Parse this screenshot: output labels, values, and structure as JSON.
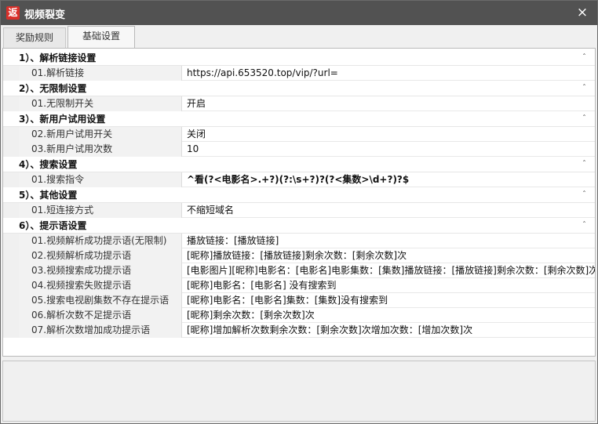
{
  "window": {
    "title": "视频裂变",
    "icon_glyph": "返",
    "close_glyph": "×"
  },
  "tabs": [
    {
      "label": "奖励规则",
      "active": false
    },
    {
      "label": "基础设置",
      "active": true
    }
  ],
  "categories": [
    {
      "title": "1）、解析链接设置",
      "rows": [
        {
          "name": "01.解析链接",
          "value": "https://api.653520.top/vip/?url="
        }
      ]
    },
    {
      "title": "2）、无限制设置",
      "rows": [
        {
          "name": "01.无限制开关",
          "value": "开启"
        }
      ]
    },
    {
      "title": "3）、新用户试用设置",
      "rows": [
        {
          "name": "02.新用户试用开关",
          "value": "关闭"
        },
        {
          "name": "03.新用户试用次数",
          "value": "10"
        }
      ]
    },
    {
      "title": "4）、搜索设置",
      "rows": [
        {
          "name": "01.搜索指令",
          "value": "^看(?<电影名>.+?)(?:\\s+?)?(?<集数>\\d+?)?$"
        }
      ]
    },
    {
      "title": "5）、其他设置",
      "rows": [
        {
          "name": "01.短连接方式",
          "value": "不缩短域名"
        }
      ]
    },
    {
      "title": "6）、提示语设置",
      "rows": [
        {
          "name": "01.视频解析成功提示语(无限制)",
          "value": "播放链接：[播放链接]"
        },
        {
          "name": "02.视频解析成功提示语",
          "value": "[昵称]播放链接：[播放链接]剩余次数：[剩余次数]次"
        },
        {
          "name": "03.视频搜索成功提示语",
          "value": "[电影图片][昵称]电影名：[电影名]电影集数：[集数]播放链接：[播放链接]剩余次数：[剩余次数]次"
        },
        {
          "name": "04.视频搜索失败提示语",
          "value": "[昵称]电影名：[电影名] 没有搜索到"
        },
        {
          "name": "05.搜索电视剧集数不存在提示语",
          "value": "[昵称]电影名：[电影名]集数：[集数]没有搜索到"
        },
        {
          "name": "06.解析次数不足提示语",
          "value": "[昵称]剩余次数：[剩余次数]次"
        },
        {
          "name": "07.解析次数增加成功提示语",
          "value": "[昵称]增加解析次数剩余次数：[剩余次数]次增加次数：[增加次数]次"
        }
      ]
    }
  ],
  "collapse_glyph": "ˆ"
}
